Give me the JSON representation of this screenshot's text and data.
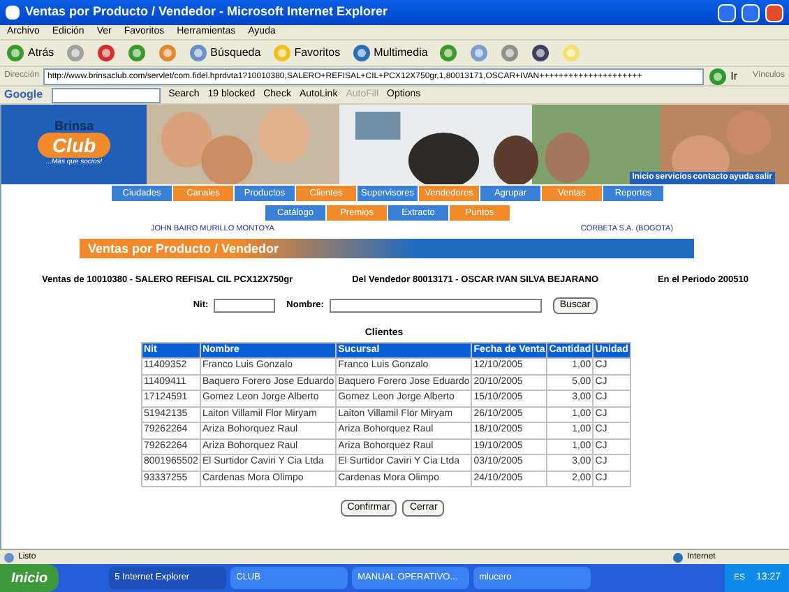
{
  "window": {
    "title": "Ventas por Producto / Vendedor - Microsoft Internet Explorer"
  },
  "menu": [
    "Archivo",
    "Edición",
    "Ver",
    "Favoritos",
    "Herramientas",
    "Ayuda"
  ],
  "toolbar": {
    "back": "Atrás",
    "search": "Búsqueda",
    "favorites": "Favoritos",
    "media": "Multimedia"
  },
  "address": {
    "label": "Dirección",
    "value": "http://www.brinsaclub.com/servlet/com.fidel.hprdvta1?10010380,SALERO+REFISAL+CIL+PCX12X750gr,1,80013171,OSCAR+IVAN+++++++++++++++++++++",
    "go": "Ir",
    "links": "Vínculos"
  },
  "google_bar": {
    "logo": "Google",
    "search": "Search",
    "blocked": "19 blocked",
    "check": "Check",
    "autolink": "AutoLink",
    "autofill": "AutoFill",
    "options": "Options"
  },
  "site": {
    "logo_top": "Brinsa",
    "logo_bottom": "Club",
    "slogan": "...Más que socios!",
    "top_links": [
      "Inicio",
      "servicios",
      "contacto",
      "ayuda",
      "salir"
    ],
    "nav": [
      {
        "label": "Ciudades",
        "color": "#3a80d6"
      },
      {
        "label": "Canales",
        "color": "#f08a2a"
      },
      {
        "label": "Productos",
        "color": "#3a80d6"
      },
      {
        "label": "Clientes",
        "color": "#f08a2a"
      },
      {
        "label": "Supervisores",
        "color": "#3a80d6"
      },
      {
        "label": "Vendedores",
        "color": "#f08a2a"
      },
      {
        "label": "Agrupar",
        "color": "#3a80d6"
      },
      {
        "label": "Ventas",
        "color": "#f08a2a"
      },
      {
        "label": "Reportes",
        "color": "#3a80d6"
      }
    ],
    "subnav": [
      {
        "label": "Catálogo",
        "color": "#3a80d6"
      },
      {
        "label": "Premios",
        "color": "#f08a2a"
      },
      {
        "label": "Extracto",
        "color": "#3a80d6"
      },
      {
        "label": "Puntos",
        "color": "#f08a2a"
      }
    ],
    "user": "JOHN BAIRO MURILLO MONTOYA",
    "company": "CORBETA S.A. (BOGOTA)",
    "page_title": "Ventas por Producto / Vendedor"
  },
  "summary": {
    "product": "Ventas de 10010380  -  SALERO REFISAL CIL PCX12X750gr",
    "seller": "Del Vendedor 80013171  -  OSCAR IVAN SILVA BEJARANO",
    "period": "En el Periodo 200510"
  },
  "search": {
    "nit_label": "Nit:",
    "name_label": "Nombre:",
    "button": "Buscar"
  },
  "table": {
    "caption": "Clientes",
    "columns": [
      "Nit",
      "Nombre",
      "Sucursal",
      "Fecha de Venta",
      "Cantidad",
      "Unidad"
    ],
    "rows": [
      [
        "11409352",
        "Franco Luis Gonzalo",
        "Franco Luis Gonzalo",
        "12/10/2005",
        "1,00",
        "CJ"
      ],
      [
        "11409411",
        "Baquero Forero Jose Eduardo",
        "Baquero Forero Jose Eduardo",
        "20/10/2005",
        "5,00",
        "CJ"
      ],
      [
        "17124591",
        "Gomez Leon Jorge Alberto",
        "Gomez Leon Jorge Alberto",
        "15/10/2005",
        "3,00",
        "CJ"
      ],
      [
        "51942135",
        "Laiton Villamil Flor Miryam",
        "Laiton Villamil Flor Miryam",
        "26/10/2005",
        "1,00",
        "CJ"
      ],
      [
        "79262264",
        "Ariza Bohorquez Raul",
        "Ariza Bohorquez Raul",
        "18/10/2005",
        "1,00",
        "CJ"
      ],
      [
        "79262264",
        "Ariza Bohorquez Raul",
        "Ariza Bohorquez Raul",
        "19/10/2005",
        "1,00",
        "CJ"
      ],
      [
        "8001965502",
        "El Surtidor Caviri Y Cia Ltda",
        "El Surtidor Caviri Y Cia Ltda",
        "03/10/2005",
        "3,00",
        "CJ"
      ],
      [
        "93337255",
        "Cardenas Mora Olimpo",
        "Cardenas Mora Olimpo",
        "24/10/2005",
        "2,00",
        "CJ"
      ]
    ]
  },
  "buttons": [
    "Confirmar",
    "Cerrar"
  ],
  "status_bar": {
    "text": "Listo",
    "zone": "Internet"
  },
  "taskbar": {
    "start": "Inicio",
    "items": [
      "5 Internet Explorer",
      "CLUB",
      "MANUAL OPERATIVO...",
      "mlucero"
    ],
    "lang": "ES",
    "clock": "13:27"
  }
}
